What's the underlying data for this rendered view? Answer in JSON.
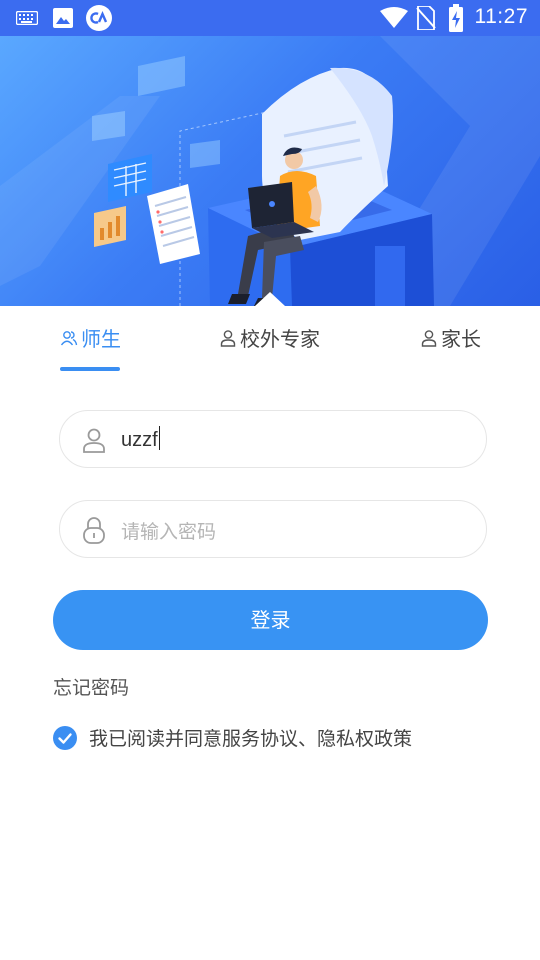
{
  "status_bar": {
    "time": "11:27",
    "icons": [
      "keyboard-icon",
      "image-icon",
      "app-logo-icon",
      "wifi-icon",
      "no-sim-icon",
      "battery-charging-icon"
    ]
  },
  "banner": {
    "illustration": "person-with-laptop-on-cube"
  },
  "tabs": [
    {
      "label": "师生",
      "icon": "group-user-icon",
      "active": true
    },
    {
      "label": "校外专家",
      "icon": "user-icon",
      "active": false
    },
    {
      "label": "家长",
      "icon": "user-icon",
      "active": false
    }
  ],
  "form": {
    "username_value": "uzzf",
    "password_placeholder": "请输入密码"
  },
  "login_button": "登录",
  "forgot_password": "忘记密码",
  "agreement": {
    "checked": true,
    "text": "我已阅读并同意服务协议、隐私权政策"
  },
  "colors": {
    "accent": "#3a8ef2",
    "status_bar": "#3b6cf0",
    "button": "#3893f3"
  }
}
